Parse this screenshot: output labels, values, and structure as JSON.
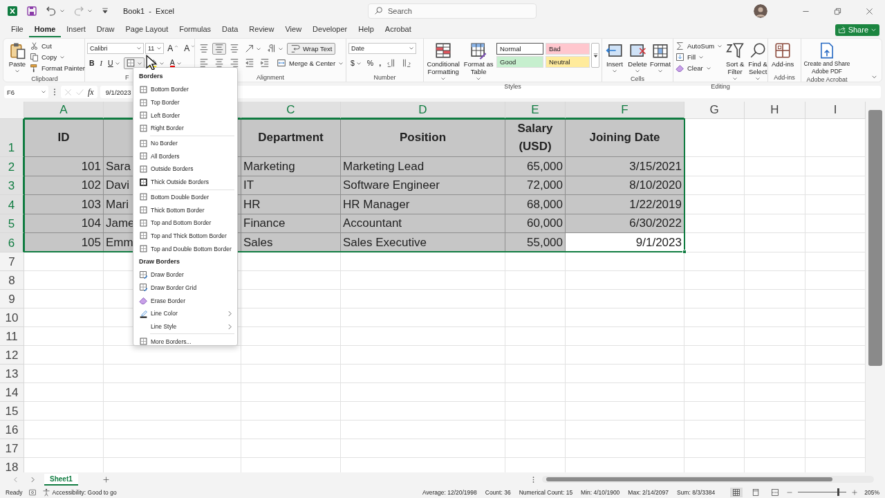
{
  "title_bar": {
    "title": "Book1  -  Excel",
    "search": {
      "placeholder": "Search"
    }
  },
  "menu_tabs": [
    {
      "label": "File",
      "selected": false
    },
    {
      "label": "Home",
      "selected": true
    },
    {
      "label": "Insert",
      "selected": false
    },
    {
      "label": "Draw",
      "selected": false
    },
    {
      "label": "Page Layout",
      "selected": false
    },
    {
      "label": "Formulas",
      "selected": false
    },
    {
      "label": "Data",
      "selected": false
    },
    {
      "label": "Review",
      "selected": false
    },
    {
      "label": "View",
      "selected": false
    },
    {
      "label": "Developer",
      "selected": false
    },
    {
      "label": "Help",
      "selected": false
    },
    {
      "label": "Acrobat",
      "selected": false
    }
  ],
  "share_button": {
    "label": "Share"
  },
  "ribbon": {
    "groups": [
      {
        "name": "Clipboard",
        "blocks": [
          {
            "kind": "large",
            "lines": [
              "Paste"
            ],
            "caret": true
          },
          {
            "kind": "stack",
            "items": [
              {
                "label": "Cut"
              },
              {
                "label": "Copy",
                "caret": true
              },
              {
                "label": "Format Painter"
              }
            ]
          }
        ]
      },
      {
        "name": "F",
        "blocks": [
          {
            "kind": "toolbar",
            "rows": [
              {
                "items": [
                  {
                    "kind": "field",
                    "value": "Calibri"
                  },
                  {
                    "kind": "field",
                    "value": "11"
                  },
                  {
                    "kind": "grow",
                    "text": "A"
                  },
                  {
                    "kind": "shrink",
                    "text": "A"
                  }
                ]
              },
              {
                "items": [
                  {
                    "kind": "bold",
                    "text": "B"
                  },
                  {
                    "kind": "italic",
                    "text": "I"
                  },
                  {
                    "kind": "underline",
                    "text": "U",
                    "caret": true
                  },
                  {
                    "kind": "button",
                    "pressed": true,
                    "caret": true
                  },
                  {
                    "kind": "button",
                    "caret": true
                  },
                  {
                    "kind": "color",
                    "text": "A",
                    "caret": true
                  }
                ]
              }
            ]
          }
        ]
      },
      {
        "name": "Alignment",
        "blocks": [
          {
            "kind": "toolbar",
            "rows": [
              {
                "items": [
                  {
                    "kind": "button"
                  },
                  {
                    "kind": "button",
                    "pressed": true
                  },
                  {
                    "kind": "button"
                  },
                  {
                    "kind": "button",
                    "caret": true
                  },
                  {
                    "kind": "button",
                    "caret": true
                  },
                  {
                    "kind": "button",
                    "label": "Wrap Text",
                    "pressed": true
                  }
                ]
              },
              {
                "items": [
                  {
                    "kind": "button"
                  },
                  {
                    "kind": "button"
                  },
                  {
                    "kind": "button"
                  },
                  {
                    "kind": "button"
                  },
                  {
                    "kind": "button"
                  },
                  {
                    "kind": "button",
                    "label": "Merge & Center",
                    "caret": true
                  }
                ]
              }
            ]
          }
        ]
      },
      {
        "name": "Number",
        "blocks": [
          {
            "kind": "toolbar",
            "rows": [
              {
                "items": [
                  {
                    "kind": "field",
                    "value": "Date"
                  }
                ]
              },
              {
                "items": [
                  {
                    "kind": "button",
                    "text": "$",
                    "caret": true
                  },
                  {
                    "kind": "button",
                    "text": "%"
                  },
                  {
                    "kind": "bold",
                    "text": ","
                  },
                  {
                    "kind": "button"
                  },
                  {
                    "kind": "button"
                  }
                ]
              }
            ]
          }
        ]
      },
      {
        "name": "Styles",
        "blocks": [
          {
            "kind": "large",
            "lines": [
              "Conditional",
              "Formatting"
            ],
            "caret": true
          },
          {
            "kind": "large",
            "lines": [
              "Format as",
              "Table"
            ],
            "caret": true
          },
          {
            "kind": "gallery",
            "styles": [
              {
                "label": "Normal",
                "color": "#ffffff"
              },
              {
                "label": "Bad",
                "color": "#ffc7ce"
              },
              {
                "label": "Good",
                "color": "#c6efce"
              },
              {
                "label": "Neutral",
                "color": "#ffeb9c"
              }
            ]
          }
        ]
      },
      {
        "name": "Cells",
        "blocks": [
          {
            "kind": "large",
            "lines": [
              "Insert"
            ],
            "caret": true
          },
          {
            "kind": "large",
            "lines": [
              "Delete"
            ],
            "caret": true
          },
          {
            "kind": "large",
            "lines": [
              "Format"
            ],
            "caret": true
          }
        ]
      },
      {
        "name": "Editing",
        "blocks": [
          {
            "kind": "stack",
            "items": [
              {
                "label": "AutoSum",
                "caret": true
              },
              {
                "label": "Fill",
                "caret": true
              },
              {
                "label": "Clear",
                "caret": true
              }
            ]
          },
          {
            "kind": "large",
            "lines": [
              "Sort &",
              "Filter"
            ],
            "caret": true
          },
          {
            "kind": "large",
            "lines": [
              "Find &",
              "Select"
            ],
            "caret": true
          }
        ]
      },
      {
        "name": "Add-ins",
        "blocks": [
          {
            "kind": "large",
            "lines": [
              "Add-ins"
            ],
            "caret": false
          }
        ]
      },
      {
        "name": "Adobe Acrobat",
        "blocks": [
          {
            "kind": "large",
            "lines": [
              "Create and Share",
              "Adobe PDF"
            ],
            "caret": false
          }
        ]
      }
    ]
  },
  "formula_bar": {
    "name_box": "F6",
    "fx": "fx",
    "value": "9/1/2023"
  },
  "sheet": {
    "column_headers": [
      {
        "label": "A",
        "selected": true
      },
      {
        "selected": true
      },
      {
        "label": "C",
        "selected": true
      },
      {
        "label": "D",
        "selected": true
      },
      {
        "label": "E",
        "selected": true
      },
      {
        "label": "F",
        "selected": true
      },
      {
        "label": "G",
        "selected": false
      },
      {
        "label": "H",
        "selected": false
      },
      {
        "label": "I",
        "selected": false
      }
    ],
    "rows": [
      {
        "number": "1",
        "selected": true,
        "cells": [
          {
            "kind": "header",
            "text": "ID",
            "selected": true
          },
          {
            "kind": "header",
            "selected": true
          },
          {
            "kind": "header",
            "text": "Department",
            "selected": true
          },
          {
            "kind": "header",
            "text": "Position",
            "selected": true
          },
          {
            "kind": "header",
            "text": "Salary (USD)",
            "selected": true
          },
          {
            "kind": "header",
            "text": "Joining Date",
            "selected": true
          }
        ]
      },
      {
        "number": "2",
        "selected": true,
        "cells": [
          {
            "kind": "number",
            "text": "101",
            "selected": true
          },
          {
            "kind": "text",
            "text": "Sara",
            "selected": true
          },
          {
            "kind": "text",
            "text": "Marketing",
            "selected": true
          },
          {
            "kind": "text",
            "text": "Marketing Lead",
            "selected": true
          },
          {
            "kind": "number",
            "text": "65,000",
            "selected": true
          },
          {
            "kind": "number",
            "text": "3/15/2021",
            "selected": true
          }
        ]
      },
      {
        "number": "3",
        "selected": true,
        "cells": [
          {
            "kind": "number",
            "text": "102",
            "selected": true
          },
          {
            "kind": "text",
            "text": "Davi",
            "selected": true
          },
          {
            "kind": "text",
            "text": "IT",
            "selected": true
          },
          {
            "kind": "text",
            "text": "Software Engineer",
            "selected": true
          },
          {
            "kind": "number",
            "text": "72,000",
            "selected": true
          },
          {
            "kind": "number",
            "text": "8/10/2020",
            "selected": true
          }
        ]
      },
      {
        "number": "4",
        "selected": true,
        "cells": [
          {
            "kind": "number",
            "text": "103",
            "selected": true
          },
          {
            "kind": "text",
            "text": "Mari",
            "selected": true
          },
          {
            "kind": "text",
            "text": "HR",
            "selected": true
          },
          {
            "kind": "text",
            "text": "HR Manager",
            "selected": true
          },
          {
            "kind": "number",
            "text": "68,000",
            "selected": true
          },
          {
            "kind": "number",
            "text": "1/22/2019",
            "selected": true
          }
        ]
      },
      {
        "number": "5",
        "selected": true,
        "cells": [
          {
            "kind": "number",
            "text": "104",
            "selected": true
          },
          {
            "kind": "text",
            "text": "Jame",
            "selected": true
          },
          {
            "kind": "text",
            "text": "Finance",
            "selected": true
          },
          {
            "kind": "text",
            "text": "Accountant",
            "selected": true
          },
          {
            "kind": "number",
            "text": "60,000",
            "selected": true
          },
          {
            "kind": "number",
            "text": "6/30/2022",
            "selected": true
          }
        ]
      },
      {
        "number": "6",
        "selected": true,
        "cells": [
          {
            "kind": "number",
            "text": "105",
            "selected": true
          },
          {
            "kind": "text",
            "text": "Emm",
            "selected": true
          },
          {
            "kind": "text",
            "text": "Sales",
            "selected": true
          },
          {
            "kind": "text",
            "text": "Sales Executive",
            "selected": true
          },
          {
            "kind": "number",
            "text": "55,000",
            "selected": true
          },
          {
            "kind": "number",
            "text": "9/1/2023",
            "selected": true,
            "active": true
          }
        ]
      },
      {
        "number": "7",
        "selected": false
      },
      {
        "number": "8",
        "selected": false
      },
      {
        "number": "9",
        "selected": false
      },
      {
        "number": "10",
        "selected": false
      },
      {
        "number": "11",
        "selected": false
      },
      {
        "number": "12",
        "selected": false
      },
      {
        "number": "13",
        "selected": false
      },
      {
        "number": "14",
        "selected": false
      },
      {
        "number": "15",
        "selected": false
      },
      {
        "number": "16",
        "selected": false
      },
      {
        "number": "17",
        "selected": false
      },
      {
        "number": "18",
        "selected": false
      }
    ]
  },
  "borders_menu": {
    "sections": [
      {
        "title": "Borders",
        "groups": [
          [
            {
              "label": "Bottom Border"
            },
            {
              "label": "Top Border"
            },
            {
              "label": "Left Border"
            },
            {
              "label": "Right Border"
            }
          ],
          [
            {
              "label": "No Border"
            },
            {
              "label": "All Borders"
            },
            {
              "label": "Outside Borders"
            },
            {
              "label": "Thick Outside Borders"
            }
          ],
          [
            {
              "label": "Bottom Double Border"
            },
            {
              "label": "Thick Bottom Border"
            },
            {
              "label": "Top and Bottom Border"
            },
            {
              "label": "Top and Thick Bottom Border"
            },
            {
              "label": "Top and Double Bottom Border"
            }
          ]
        ]
      },
      {
        "title": "Draw Borders",
        "groups": [
          [
            {
              "label": "Draw Border"
            },
            {
              "label": "Draw Border Grid"
            },
            {
              "label": "Erase Border"
            },
            {
              "label": "Line Color",
              "submenu": true
            },
            {
              "label": "Line Style",
              "submenu": true
            }
          ],
          [
            {
              "label": "More Borders..."
            }
          ]
        ]
      }
    ]
  },
  "sheet_tabs": [
    {
      "label": "Sheet1",
      "selected": true
    }
  ],
  "status_bar": {
    "mode": "Ready",
    "accessibility": "Accessibility: Good to go",
    "stats": [
      "Average: 12/20/1998",
      "Count: 36",
      "Numerical Count: 15",
      "Min: 4/10/1900",
      "Max: 2/14/2097",
      "Sum: 8/3/3384"
    ],
    "zoom": {
      "level": 0.82,
      "label": "205%"
    }
  }
}
